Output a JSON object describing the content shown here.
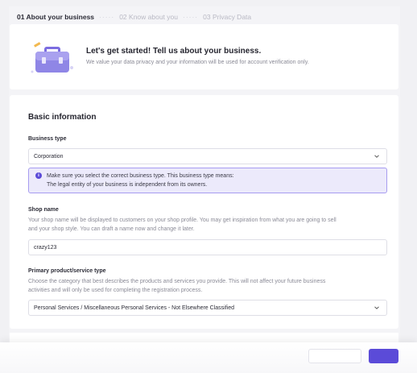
{
  "stepper": {
    "steps": [
      {
        "label": "01 About your business",
        "state": "active"
      },
      {
        "label": "02 Know about you",
        "state": "inactive"
      },
      {
        "label": "03 Privacy Data",
        "state": "inactive"
      }
    ],
    "separator": "·····"
  },
  "hero": {
    "icon": "briefcase-icon",
    "title": "Let's get started! Tell us about your business.",
    "subtitle": "We value your data privacy and your information will be used for account verification only."
  },
  "form": {
    "section_title": "Basic information",
    "business_type": {
      "label": "Business type",
      "value": "Corporation"
    },
    "notice": {
      "line1": "Make sure you select the correct business type. This business type means:",
      "line2": "The legal entity of your business is independent from its owners."
    },
    "shop_name": {
      "label": "Shop name",
      "help_line1": "Your shop name will be displayed to customers on your shop profile. You may get inspiration from what you are going to sell",
      "help_line2": "and your shop style. You can draft a name now and change it later.",
      "value": "crazy123"
    },
    "primary_category": {
      "label": "Primary product/service type",
      "help_line1": "Choose the category that best describes the products and services you provide. This will not affect your future business",
      "help_line2": "activities and will only be used for completing the registration process.",
      "value": "Personal Services / Miscellaneous Personal Services - Not Elsewhere Classified"
    }
  },
  "colors": {
    "accent": "#5b4bd8",
    "notice_bg": "#eceafb",
    "notice_border": "#a79cf0"
  }
}
